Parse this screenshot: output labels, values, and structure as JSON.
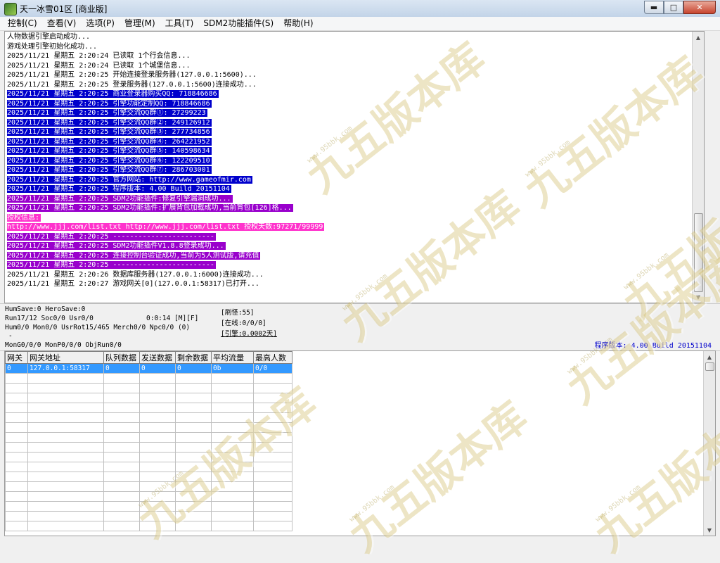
{
  "window": {
    "title": "天一冰雪01区 [商业版]"
  },
  "menu": [
    "控制(C)",
    "查看(V)",
    "选项(P)",
    "管理(M)",
    "工具(T)",
    "SDM2功能插件(S)",
    "帮助(H)"
  ],
  "log": [
    {
      "text": "人物数据引擎启动成功...",
      "fg": "#000000",
      "bg": ""
    },
    {
      "text": "游戏处理引擎初始化成功...",
      "fg": "#000000",
      "bg": ""
    },
    {
      "text": "2025/11/21 星期五 2:20:24 已读取 1个行会信息...",
      "fg": "#000000",
      "bg": ""
    },
    {
      "text": "2025/11/21 星期五 2:20:24 已读取 1个城堡信息...",
      "fg": "#000000",
      "bg": ""
    },
    {
      "text": "2025/11/21 星期五 2:20:25 开始连接登录服务器(127.0.0.1:5600)...",
      "fg": "#000000",
      "bg": ""
    },
    {
      "text": "2025/11/21 星期五 2:20:25 登录服务器(127.0.0.1:5600)连接成功...",
      "fg": "#000000",
      "bg": ""
    },
    {
      "text": "2025/11/21 星期五 2:20:25 商业登录器购买QQ: 718846686",
      "fg": "#ffffff",
      "bg": "#0000cc"
    },
    {
      "text": "2025/11/21 星期五 2:20:25 引擎功能定制QQ: 718846686",
      "fg": "#ffffff",
      "bg": "#0000cc"
    },
    {
      "text": "2025/11/21 星期五 2:20:25 引擎交流QQ群①: 27299223",
      "fg": "#ffffff",
      "bg": "#0000cc"
    },
    {
      "text": "2025/11/21 星期五 2:20:25 引擎交流QQ群②: 249126912",
      "fg": "#ffffff",
      "bg": "#0000cc"
    },
    {
      "text": "2025/11/21 星期五 2:20:25 引擎交流QQ群③: 277734856",
      "fg": "#ffffff",
      "bg": "#0000cc"
    },
    {
      "text": "2025/11/21 星期五 2:20:25 引擎交流QQ群④: 264221952",
      "fg": "#ffffff",
      "bg": "#0000cc"
    },
    {
      "text": "2025/11/21 星期五 2:20:25 引擎交流QQ群⑤: 140598634",
      "fg": "#ffffff",
      "bg": "#0000cc"
    },
    {
      "text": "2025/11/21 星期五 2:20:25 引擎交流QQ群⑥: 122209510",
      "fg": "#ffffff",
      "bg": "#0000cc"
    },
    {
      "text": "2025/11/21 星期五 2:20:25 引擎交流QQ群⑦: 286703001",
      "fg": "#ffffff",
      "bg": "#0000cc"
    },
    {
      "text": "2025/11/21 星期五 2:20:25 官方网站: http://www.gameofmir.com",
      "fg": "#ffffff",
      "bg": "#0000cc"
    },
    {
      "text": "2025/11/21 星期五 2:20:25 程序版本: 4.00 Build 20151104",
      "fg": "#ffffff",
      "bg": "#0000cc"
    },
    {
      "text": "2025/11/21 星期五 2:20:25 SDM2功能插件:修复引擎漏洞成功...",
      "fg": "#ffffff",
      "bg": "#9900cc"
    },
    {
      "text": "2025/11/21 星期五 2:20:25 SDM2功能插件:扩展背包加载成功,当前背包[126]格...",
      "fg": "#ffffff",
      "bg": "#9900cc"
    },
    {
      "text": "授权信息:",
      "fg": "#ffffff",
      "bg": "#ff33cc"
    },
    {
      "text": "http://www.jjj.com/list.txt http://www.jjj.com/list.txt 授权天数:97271/99999",
      "fg": "#ffffff",
      "bg": "#ff33cc"
    },
    {
      "text": "2025/11/21 星期五 2:20:25 ------------------------",
      "fg": "#ffffff",
      "bg": "#9900cc"
    },
    {
      "text": "2025/11/21 星期五 2:20:25 SDM2功能插件V1.8.8登录成功...",
      "fg": "#ffffff",
      "bg": "#9900cc"
    },
    {
      "text": "2025/11/21 星期五 2:20:25 连接控制台验证成功,当前为5人测试版,请充值",
      "fg": "#ffffff",
      "bg": "#9900cc"
    },
    {
      "text": "2025/11/21 星期五 2:20:25 ------------------------",
      "fg": "#ffffff",
      "bg": "#9900cc"
    },
    {
      "text": "2025/11/21 星期五 2:20:26 数据库服务器(127.0.0.1:6000)连接成功...",
      "fg": "#000000",
      "bg": ""
    },
    {
      "text": "2025/11/21 星期五 2:20:27 游戏网关[0](127.0.0.1:58317)已打开...",
      "fg": "#000000",
      "bg": ""
    }
  ],
  "status": {
    "humsave": "HumSave:0 HeroSave:0",
    "run": "Run17/12 Soc0/0 Usr0/0",
    "timer": "0:0:14 [M][F]",
    "hum": "Hum0/0 Mon0/0 UsrRot15/465 Merch0/0 Npc0/0 (0)",
    "dash": "-",
    "mong": "MonG0/0/0 MonP0/0/0 ObjRun0/0",
    "refresh": "[刷怪:55]",
    "online": "[在线:0/0/0]",
    "engine": "[引擎:0.0002天]",
    "version": "程序版本: 4.00 Build 20151104"
  },
  "grid": {
    "headers": [
      "网关",
      "网关地址",
      "队列数据",
      "发送数据",
      "剩余数据",
      "平均流量",
      "最高人数"
    ],
    "rows": [
      [
        "0",
        "127.0.0.1:58317",
        "0",
        "0",
        "0",
        "0b",
        "0/0"
      ]
    ],
    "empty_rows": 16
  },
  "watermark": {
    "text": "九五版本库",
    "url": "www.95bbk.com"
  }
}
